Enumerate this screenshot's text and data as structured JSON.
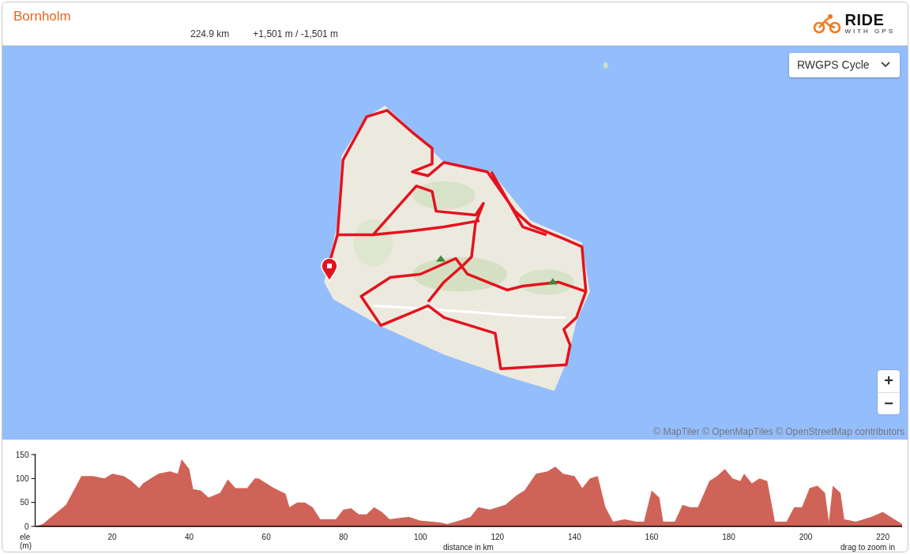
{
  "route": {
    "title": "Bornholm",
    "distance": "224.9 km",
    "elevation_gain_loss": "+1,501 m / -1,501 m"
  },
  "logo": {
    "word": "RIDE",
    "tagline": "WITH GPS"
  },
  "map": {
    "kind": "picture",
    "layer_select": {
      "value": "RWGPS Cycle"
    },
    "zoom_controls": [
      "+",
      "−"
    ],
    "attribution": "© MapTiler © OpenMapTiles © OpenStreetMap contributors"
  },
  "elevation": {
    "hint": "drag to zoom in",
    "chart_data": {
      "type": "area",
      "xlabel": "distance in km",
      "ylabel": "ele (m)",
      "xlim": [
        0,
        225
      ],
      "ylim": [
        0,
        150
      ],
      "xticks": [
        20,
        40,
        60,
        80,
        100,
        120,
        140,
        160,
        180,
        200,
        220
      ],
      "yticks": [
        0,
        50,
        100,
        150
      ],
      "x": [
        0,
        2,
        5,
        8,
        10,
        12,
        15,
        18,
        20,
        23,
        25,
        27,
        28,
        30,
        32,
        35,
        37,
        38,
        40,
        41,
        43,
        45,
        48,
        50,
        52,
        55,
        57,
        58,
        60,
        62,
        65,
        66,
        68,
        70,
        72,
        74,
        76,
        78,
        80,
        82,
        84,
        86,
        88,
        90,
        92,
        95,
        97,
        100,
        103,
        105,
        107,
        110,
        113,
        115,
        118,
        120,
        122,
        125,
        127,
        130,
        133,
        135,
        137,
        140,
        142,
        144,
        146,
        148,
        150,
        153,
        156,
        158,
        160,
        162,
        163,
        166,
        168,
        170,
        172,
        175,
        177,
        179,
        181,
        183,
        184,
        186,
        188,
        190,
        192,
        195,
        197,
        199,
        201,
        203,
        205,
        206,
        207,
        209,
        210,
        213,
        215,
        217,
        220,
        223,
        225
      ],
      "series": [
        {
          "color": "#d06357",
          "values": [
            0,
            5,
            25,
            45,
            75,
            105,
            105,
            100,
            110,
            105,
            95,
            80,
            90,
            100,
            110,
            115,
            110,
            140,
            120,
            78,
            75,
            60,
            70,
            98,
            80,
            80,
            100,
            100,
            90,
            80,
            68,
            40,
            50,
            50,
            40,
            15,
            15,
            15,
            35,
            38,
            25,
            25,
            40,
            30,
            15,
            18,
            20,
            12,
            10,
            8,
            5,
            12,
            20,
            40,
            35,
            40,
            45,
            65,
            75,
            110,
            115,
            125,
            110,
            105,
            80,
            100,
            105,
            40,
            10,
            15,
            10,
            10,
            75,
            60,
            10,
            10,
            45,
            40,
            40,
            95,
            105,
            120,
            100,
            95,
            110,
            90,
            100,
            95,
            10,
            10,
            40,
            40,
            80,
            85,
            70,
            10,
            85,
            70,
            15,
            10,
            15,
            20,
            30,
            15,
            5
          ]
        }
      ]
    }
  }
}
